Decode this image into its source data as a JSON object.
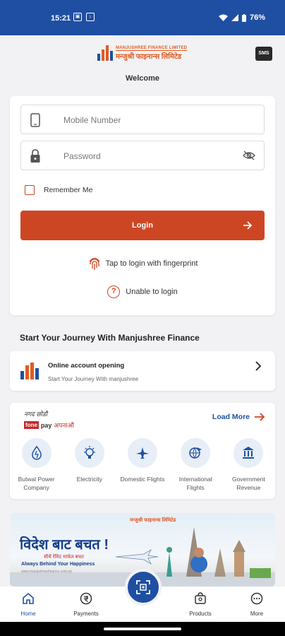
{
  "status_bar": {
    "time": "15:21",
    "battery": "76%",
    "icons": [
      "notification-icon",
      "download-icon",
      "wifi-icon",
      "signal-icon",
      "battery-icon"
    ]
  },
  "header": {
    "logo_en": "MANJUSHREE FINANCE LIMITED",
    "logo_np": "मन्जुश्री फाइनान्स लिमिटेड",
    "sms_label": "SMS",
    "welcome": "Welcome"
  },
  "login": {
    "mobile_placeholder": "Mobile Number",
    "password_placeholder": "Password",
    "remember_label": "Remember Me",
    "login_label": "Login",
    "fingerprint_label": "Tap to login with fingerprint",
    "help_label": "Unable to login"
  },
  "journey": {
    "title": "Start Your Journey With Manjushree Finance",
    "item_title": "Online account opening",
    "item_sub": "Start Your Journey With manjushree"
  },
  "fonepay": {
    "tagline": "नगद छोडौ",
    "brand_fone": "fone",
    "brand_pay": "pay",
    "brand_suffix": "अपनाऔ",
    "load_more": "Load More",
    "items": [
      {
        "label": "Butwal Power Company",
        "icon": "water-drop-icon"
      },
      {
        "label": "Electricity",
        "icon": "bulb-icon"
      },
      {
        "label": "Domestic Flights",
        "icon": "plane-icon"
      },
      {
        "label": "International Flights",
        "icon": "globe-plane-icon"
      },
      {
        "label": "Government Revenue",
        "icon": "government-building-icon"
      }
    ]
  },
  "banner": {
    "headline": "विदेश बाट बचत !",
    "sub": "सीधै रेमिट मार्फत बचत",
    "tagline": "Always Behind Your Happiness",
    "tiny": "www.manjushreefinance.com.np",
    "logo": "मन्जुश्री फाइनान्स लिमिटेड"
  },
  "nav": {
    "home": "Home",
    "payments": "Payments",
    "products": "Products",
    "more": "More"
  },
  "colors": {
    "primary": "#1f4fa3",
    "accent": "#cd4624",
    "background": "#f2f2f4"
  }
}
